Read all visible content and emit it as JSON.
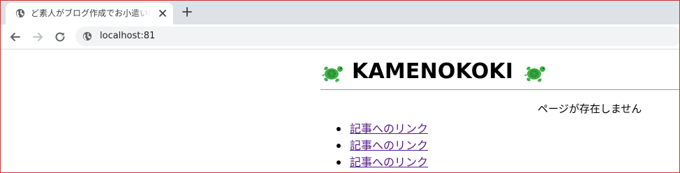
{
  "browser": {
    "tab": {
      "title": "ど素人がブログ作成でお小遣い稼ぎを",
      "favicon_icon": "globe-icon",
      "close_icon": "close-icon"
    },
    "new_tab_icon": "plus-icon",
    "toolbar": {
      "back_icon": "arrow-left-icon",
      "forward_icon": "arrow-right-icon",
      "reload_icon": "reload-icon",
      "site_icon": "globe-icon",
      "url": "localhost:81"
    }
  },
  "page": {
    "header": {
      "title": "KAMENOKOKI",
      "logo_icon": "turtle-icon",
      "logo_color": "#3cb043"
    },
    "message": "ページが存在しません",
    "links": [
      {
        "label": "記事へのリンク"
      },
      {
        "label": "記事へのリンク"
      },
      {
        "label": "記事へのリンク"
      }
    ],
    "link_color": "#551a8b"
  },
  "colors": {
    "tabstrip": "#dee1e6",
    "omnibox": "#f1f3f4",
    "frame_border": "#d0312d"
  }
}
